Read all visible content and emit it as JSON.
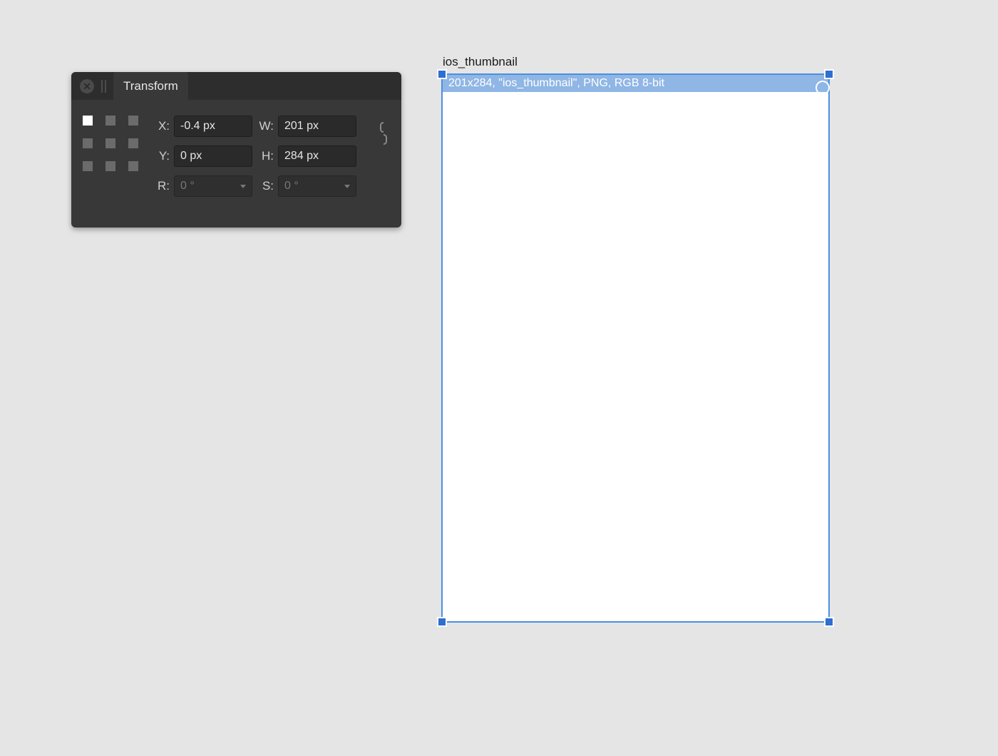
{
  "panel": {
    "tab_label": "Transform",
    "labels": {
      "x": "X:",
      "y": "Y:",
      "w": "W:",
      "h": "H:",
      "r": "R:",
      "s": "S:"
    },
    "values": {
      "x": "-0.4 px",
      "y": "0 px",
      "w": "201 px",
      "h": "284 px",
      "r": "0 °",
      "s": "0 °"
    }
  },
  "artboard": {
    "title": "ios_thumbnail",
    "header": "201x284, \"ios_thumbnail\", PNG, RGB 8-bit"
  }
}
